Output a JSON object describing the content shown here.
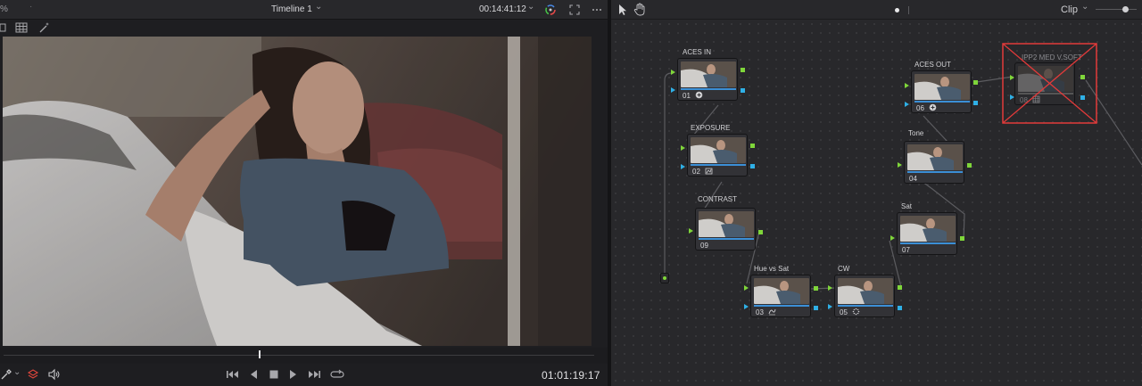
{
  "viewer": {
    "zoom_label": "%",
    "timeline_name": "Timeline 1",
    "top_timecode": "00:14:41:12",
    "bottom_timecode": "01:01:19:17",
    "icons": [
      "timeline-caret",
      "color-wheel-icon",
      "expand-icon",
      "more-options-icon",
      "single-view-icon",
      "split-view-icon",
      "magic-wand-icon",
      "picker-icon",
      "layers-icon",
      "speaker-icon",
      "skip-back-icon",
      "play-reverse-icon",
      "stop-icon",
      "play-icon",
      "skip-forward-icon",
      "loop-icon"
    ]
  },
  "node_editor": {
    "clip_label": "Clip",
    "nodes": [
      {
        "id": "n01",
        "label": "ACES IN",
        "number": "01",
        "icon": "aces-icon"
      },
      {
        "id": "n02",
        "label": "EXPOSURE",
        "number": "02",
        "icon": "curves-icon"
      },
      {
        "id": "n09",
        "label": "CONTRAST",
        "number": "09",
        "icon": ""
      },
      {
        "id": "n03",
        "label": "Hue vs Sat",
        "number": "03",
        "icon": "hue-curve-icon"
      },
      {
        "id": "n05",
        "label": "CW",
        "number": "05",
        "icon": "color-warper-icon"
      },
      {
        "id": "n07",
        "label": "Sat",
        "number": "07",
        "icon": ""
      },
      {
        "id": "n04",
        "label": "Tone",
        "number": "04",
        "icon": ""
      },
      {
        "id": "n06",
        "label": "ACES OUT",
        "number": "06",
        "icon": "aces-icon"
      },
      {
        "id": "n08",
        "label": "IPP2 MED V.SOFT",
        "number": "08",
        "icon": "lut-icon",
        "disabled": true
      }
    ],
    "colors": {
      "link": "#5c5c60",
      "rgb_port": "#7fd63a",
      "alpha_port": "#2fb0e6",
      "disabled_cross": "#e23a3a",
      "node_bar": "#3b8fd6"
    }
  }
}
